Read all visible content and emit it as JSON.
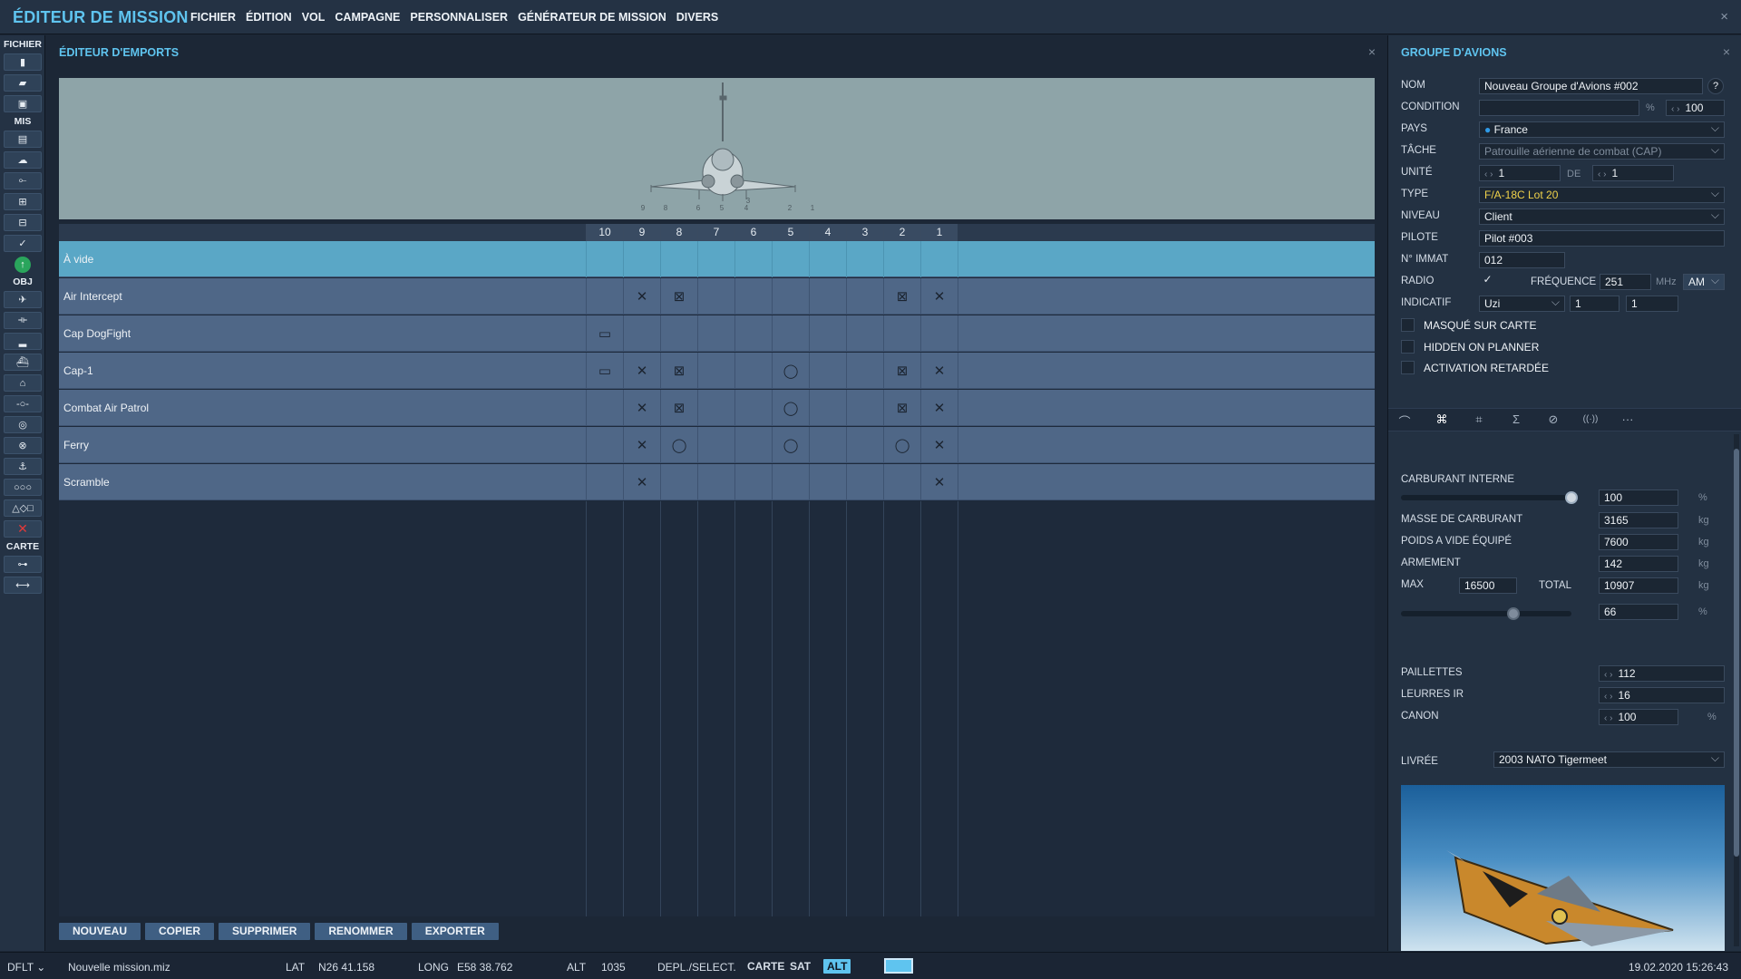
{
  "menubar": {
    "title": "ÉDITEUR DE MISSION",
    "items": [
      "FICHIER",
      "ÉDITION",
      "VOL",
      "CAMPAGNE",
      "PERSONNALISER",
      "GÉNÉRATEUR DE MISSION",
      "DIVERS"
    ],
    "close": "×"
  },
  "toolbar": {
    "sections": {
      "file": "FICHIER",
      "mis": "MIS",
      "obj": "OBJ",
      "map": "CARTE"
    },
    "icons": {
      "file": [
        "new-file-icon",
        "open-folder-icon",
        "save-icon"
      ],
      "mis": [
        "briefing-icon",
        "weather-icon",
        "aircraft-group-icon",
        "trigger-icon",
        "static-icon",
        "check-icon"
      ],
      "obj": [
        "plane-icon",
        "helicopter-icon",
        "ground-unit-icon",
        "ship-icon",
        "airbase-icon",
        "waypoint-icon",
        "target-icon",
        "circle-zone-icon",
        "naval-icon",
        "template-icon",
        "shapes-icon",
        "delete-icon"
      ],
      "map": [
        "map-options-icon",
        "ruler-icon"
      ]
    }
  },
  "loadout": {
    "title": "ÉDITEUR D'EMPORTS",
    "close": "×",
    "pylons": [
      "10",
      "9",
      "8",
      "7",
      "6",
      "5",
      "4",
      "3",
      "2",
      "1"
    ],
    "aircraft_pylon_marks": [
      "9",
      "8",
      "6",
      "5",
      "4",
      "3",
      "2",
      "1"
    ],
    "rows": [
      {
        "name": "À vide",
        "selected": true,
        "cells": [
          "",
          "",
          "",
          "",
          "",
          "",
          "",
          "",
          "",
          ""
        ]
      },
      {
        "name": "Air Intercept",
        "selected": false,
        "cells": [
          "",
          "✕",
          "⊠",
          "",
          "",
          "",
          "",
          "",
          "⊠",
          "✕"
        ]
      },
      {
        "name": "Cap DogFight",
        "selected": false,
        "cells": [
          "▭",
          "",
          "",
          "",
          "",
          "",
          "",
          "",
          "",
          ""
        ]
      },
      {
        "name": "Cap-1",
        "selected": false,
        "cells": [
          "▭",
          "✕",
          "⊠",
          "",
          "",
          "◯",
          "",
          "",
          "⊠",
          "✕"
        ]
      },
      {
        "name": "Combat Air Patrol",
        "selected": false,
        "cells": [
          "",
          "✕",
          "⊠",
          "",
          "",
          "◯",
          "",
          "",
          "⊠",
          "✕"
        ]
      },
      {
        "name": "Ferry",
        "selected": false,
        "cells": [
          "",
          "✕",
          "◯",
          "",
          "",
          "◯",
          "",
          "",
          "◯",
          "✕"
        ]
      },
      {
        "name": "Scramble",
        "selected": false,
        "cells": [
          "",
          "✕",
          "",
          "",
          "",
          "",
          "",
          "",
          "",
          "✕"
        ]
      }
    ],
    "buttons": [
      "NOUVEAU",
      "COPIER",
      "SUPPRIMER",
      "RENOMMER",
      "EXPORTER"
    ]
  },
  "group": {
    "title": "GROUPE D'AVIONS",
    "close": "×",
    "labels": {
      "name": "NOM",
      "condition": "CONDITION",
      "country": "PAYS",
      "task": "TÂCHE",
      "unit": "UNITÉ",
      "of": "DE",
      "type": "TYPE",
      "skill": "NIVEAU",
      "pilot": "PILOTE",
      "tail": "N° IMMAT",
      "radio": "RADIO",
      "freq": "FRÉQUENCE",
      "callsign": "INDICATIF"
    },
    "values": {
      "name": "Nouveau Groupe d'Avions #002",
      "help": "?",
      "condition_pct_unit": "%",
      "condition": "100",
      "country": "France",
      "task": "Patrouille aérienne de combat (CAP)",
      "unit": "1",
      "unit_of": "1",
      "type": "F/A-18C Lot 20",
      "skill": "Client",
      "pilot": "Pilot #003",
      "tail": "012",
      "radio_checked": "✓",
      "freq": "251",
      "freq_unit": "MHz",
      "modulation": "AM",
      "callsign": "Uzi",
      "callsign_n1": "1",
      "callsign_n2": "1"
    },
    "checkboxes": [
      "MASQUÉ SUR CARTE",
      "HIDDEN ON PLANNER",
      "ACTIVATION RETARDÉE"
    ],
    "tabs": [
      {
        "icon": "route-icon",
        "glyph": "⌒"
      },
      {
        "icon": "payload-icon",
        "glyph": "⌘"
      },
      {
        "icon": "waypoint-actions-icon",
        "glyph": "⌗"
      },
      {
        "icon": "summary-icon",
        "glyph": "Σ"
      },
      {
        "icon": "failures-icon",
        "glyph": "⊘"
      },
      {
        "icon": "radio-icon",
        "glyph": "((·))"
      },
      {
        "icon": "more-icon",
        "glyph": "···"
      }
    ],
    "fuel": {
      "internal_label": "CARBURANT INTERNE",
      "internal_value": "100",
      "internal_pct": 100,
      "pct_unit": "%",
      "mass_label": "MASSE DE CARBURANT",
      "mass": "3165",
      "empty_label": "POIDS A VIDE ÉQUIPÉ",
      "empty": "7600",
      "weapons_label": "ARMEMENT",
      "weapons": "142",
      "max_label": "MAX",
      "max": "16500",
      "total_label": "TOTAL",
      "total": "10907",
      "weight_pct": "66",
      "weight_pct_num": 66,
      "kg": "kg"
    },
    "counter": {
      "chaff_label": "PAILLETTES",
      "chaff": "112",
      "flare_label": "LEURRES IR",
      "flare": "16",
      "gun_label": "CANON",
      "gun": "100"
    },
    "livery_label": "LIVRÉE",
    "livery": "2003 NATO Tigermeet"
  },
  "status": {
    "profile": "DFLT",
    "file": "Nouvelle mission.miz",
    "lat_label": "LAT",
    "lat": "N26 41.158",
    "long_label": "LONG",
    "long": "E58 38.762",
    "alt_label": "ALT",
    "alt": "1035",
    "mode": "DEPL./SELECT.",
    "map_btn": "CARTE",
    "sat_btn": "SAT",
    "alt_btn": "ALT",
    "datetime": "19.02.2020 15:26:43"
  },
  "colors": {
    "accent": "#5fc4ef",
    "selected_row": "#5aa7c6",
    "row": "#4f6787",
    "type_text": "#f0d24a"
  }
}
